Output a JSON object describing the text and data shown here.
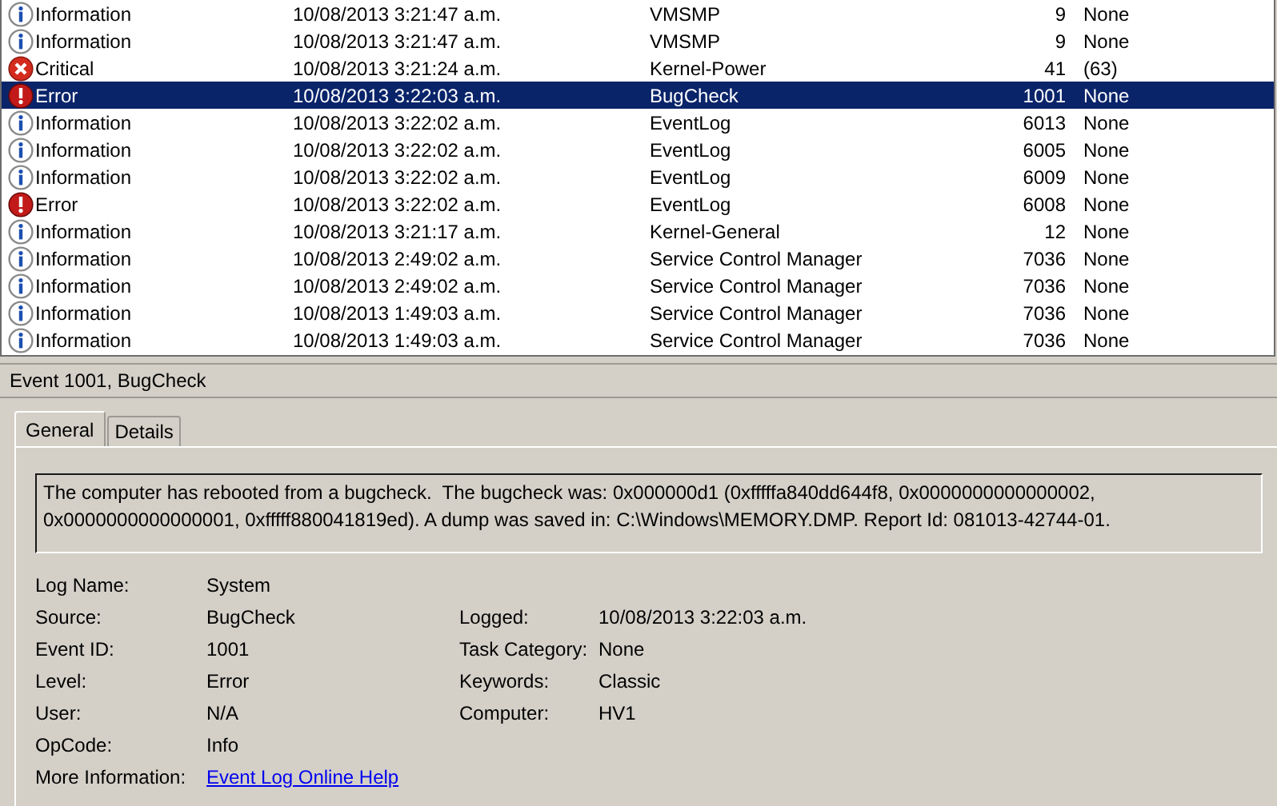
{
  "events": {
    "rows": [
      {
        "kind": "information",
        "level": "Information",
        "date": "10/08/2013 3:21:47 a.m.",
        "source": "VMSMP",
        "event_id": "9",
        "task_category": "None",
        "selected": false
      },
      {
        "kind": "information",
        "level": "Information",
        "date": "10/08/2013 3:21:47 a.m.",
        "source": "VMSMP",
        "event_id": "9",
        "task_category": "None",
        "selected": false
      },
      {
        "kind": "critical",
        "level": "Critical",
        "date": "10/08/2013 3:21:24 a.m.",
        "source": "Kernel-Power",
        "event_id": "41",
        "task_category": "(63)",
        "selected": false
      },
      {
        "kind": "error",
        "level": "Error",
        "date": "10/08/2013 3:22:03 a.m.",
        "source": "BugCheck",
        "event_id": "1001",
        "task_category": "None",
        "selected": true
      },
      {
        "kind": "information",
        "level": "Information",
        "date": "10/08/2013 3:22:02 a.m.",
        "source": "EventLog",
        "event_id": "6013",
        "task_category": "None",
        "selected": false
      },
      {
        "kind": "information",
        "level": "Information",
        "date": "10/08/2013 3:22:02 a.m.",
        "source": "EventLog",
        "event_id": "6005",
        "task_category": "None",
        "selected": false
      },
      {
        "kind": "information",
        "level": "Information",
        "date": "10/08/2013 3:22:02 a.m.",
        "source": "EventLog",
        "event_id": "6009",
        "task_category": "None",
        "selected": false
      },
      {
        "kind": "error",
        "level": "Error",
        "date": "10/08/2013 3:22:02 a.m.",
        "source": "EventLog",
        "event_id": "6008",
        "task_category": "None",
        "selected": false
      },
      {
        "kind": "information",
        "level": "Information",
        "date": "10/08/2013 3:21:17 a.m.",
        "source": "Kernel-General",
        "event_id": "12",
        "task_category": "None",
        "selected": false
      },
      {
        "kind": "information",
        "level": "Information",
        "date": "10/08/2013 2:49:02 a.m.",
        "source": "Service Control Manager",
        "event_id": "7036",
        "task_category": "None",
        "selected": false
      },
      {
        "kind": "information",
        "level": "Information",
        "date": "10/08/2013 2:49:02 a.m.",
        "source": "Service Control Manager",
        "event_id": "7036",
        "task_category": "None",
        "selected": false
      },
      {
        "kind": "information",
        "level": "Information",
        "date": "10/08/2013 1:49:03 a.m.",
        "source": "Service Control Manager",
        "event_id": "7036",
        "task_category": "None",
        "selected": false
      },
      {
        "kind": "information",
        "level": "Information",
        "date": "10/08/2013 1:49:03 a.m.",
        "source": "Service Control Manager",
        "event_id": "7036",
        "task_category": "None",
        "selected": false
      }
    ]
  },
  "detail": {
    "title": "Event 1001, BugCheck",
    "tabs": [
      {
        "label": "General",
        "selected": true
      },
      {
        "label": "Details",
        "selected": false
      }
    ],
    "description": "The computer has rebooted from a bugcheck.  The bugcheck was: 0x000000d1 (0xfffffa840dd644f8, 0x0000000000000002, 0x0000000000000001, 0xfffff880041819ed). A dump was saved in: C:\\Windows\\MEMORY.DMP. Report Id: 081013-42744-01.",
    "rows": [
      {
        "left": {
          "label": "Log Name:",
          "value": "System"
        }
      },
      {
        "left": {
          "label": "Source:",
          "value": "BugCheck"
        },
        "right": {
          "label": "Logged:",
          "value": "10/08/2013 3:22:03 a.m."
        }
      },
      {
        "left": {
          "label": "Event ID:",
          "value": "1001"
        },
        "right": {
          "label": "Task Category:",
          "value": "None"
        }
      },
      {
        "left": {
          "label": "Level:",
          "value": "Error"
        },
        "right": {
          "label": "Keywords:",
          "value": "Classic"
        }
      },
      {
        "left": {
          "label": "User:",
          "value": "N/A"
        },
        "right": {
          "label": "Computer:",
          "value": "HV1"
        }
      },
      {
        "left": {
          "label": "OpCode:",
          "value": "Info"
        }
      }
    ],
    "more_information": {
      "label": "More Information:",
      "link": "Event Log Online Help"
    }
  }
}
